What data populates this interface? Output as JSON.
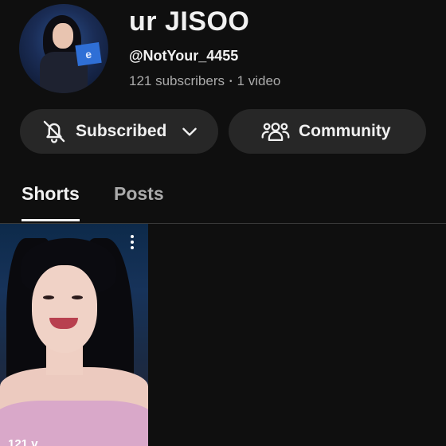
{
  "channel": {
    "title": "ur JISOO",
    "handle": "@NotYour_4455",
    "subscribers": "121 subscribers",
    "separator": "•",
    "videos": "1 video",
    "avatar_sign_text": "e"
  },
  "actions": {
    "subscribed_label": "Subscribed",
    "community_label": "Community"
  },
  "tabs": [
    {
      "label": "Shorts",
      "active": true
    },
    {
      "label": "Posts",
      "active": false
    }
  ],
  "shorts": [
    {
      "views": "121 v"
    }
  ],
  "colors": {
    "background": "#0f0f0f",
    "pill": "#272727",
    "secondary_text": "#aaaaaa"
  },
  "icons": [
    "bell-off-icon",
    "chevron-down-icon",
    "community-icon",
    "more-vert-icon"
  ]
}
